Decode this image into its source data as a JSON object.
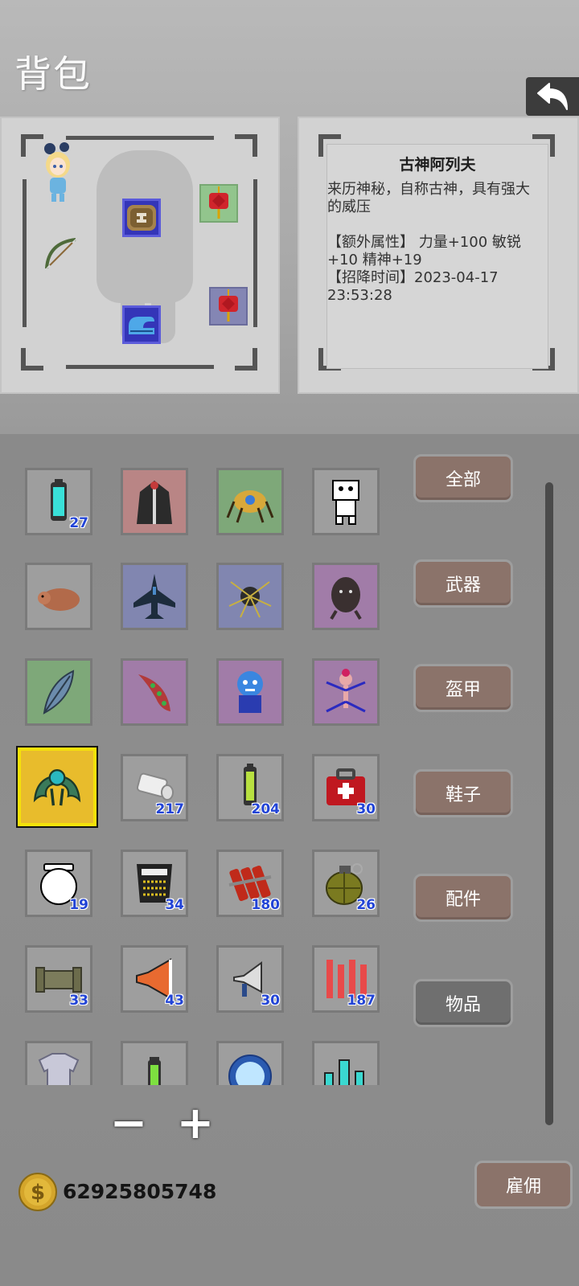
{
  "header": {
    "title": "背包",
    "back_icon": "back-arrow-icon"
  },
  "equipment": {
    "slots": [
      {
        "name": "avatar-slot",
        "icon": "chibi-girl-icon"
      },
      {
        "name": "head-slot",
        "icon": "brown-beast-head-icon"
      },
      {
        "name": "accessory-slot-1",
        "icon": "red-lantern-icon"
      },
      {
        "name": "weapon-slot",
        "icon": "bow-icon"
      },
      {
        "name": "accessory-slot-2",
        "icon": "red-lantern-icon"
      },
      {
        "name": "shoes-slot",
        "icon": "blue-boot-icon"
      }
    ]
  },
  "info": {
    "name": "古神阿列夫",
    "line1": "来历神秘，自称古神，具有强大",
    "line2": "的威压",
    "line3": "【额外属性】 力量+100 敏锐",
    "line4": "+10 精神+19",
    "line5": "【招降时间】2023-04-17",
    "line6": "23:53:28"
  },
  "items": [
    {
      "icon": "battery-cell-icon",
      "bg": "#9e9e9e",
      "qty": "27"
    },
    {
      "icon": "dark-cloak-icon",
      "bg": "#b98585",
      "qty": ""
    },
    {
      "icon": "golden-mech-creature-icon",
      "bg": "#7ea879",
      "qty": ""
    },
    {
      "icon": "white-robot-icon",
      "bg": "#9e9e9e",
      "qty": ""
    },
    {
      "icon": "boar-icon",
      "bg": "#9e9e9e",
      "qty": ""
    },
    {
      "icon": "fighter-jet-icon",
      "bg": "#8186b0",
      "qty": ""
    },
    {
      "icon": "spider-swarm-icon",
      "bg": "#8186b0",
      "qty": ""
    },
    {
      "icon": "dark-beast-icon",
      "bg": "#a17ca8",
      "qty": ""
    },
    {
      "icon": "feather-icon",
      "bg": "#7ea879",
      "qty": ""
    },
    {
      "icon": "tentacle-icon",
      "bg": "#a17ca8",
      "qty": ""
    },
    {
      "icon": "blue-goblin-icon",
      "bg": "#a17ca8",
      "qty": ""
    },
    {
      "icon": "demon-queen-icon",
      "bg": "#a17ca8",
      "qty": ""
    },
    {
      "icon": "green-mantis-icon",
      "bg": "#e8bc2c",
      "qty": "",
      "selected": true
    },
    {
      "icon": "paper-roll-icon",
      "bg": "#9e9e9e",
      "qty": "217"
    },
    {
      "icon": "battery-icon",
      "bg": "#9e9e9e",
      "qty": "204"
    },
    {
      "icon": "medkit-icon",
      "bg": "#9e9e9e",
      "qty": "30"
    },
    {
      "icon": "jar-icon",
      "bg": "#9e9e9e",
      "qty": "19"
    },
    {
      "icon": "keyboard-icon",
      "bg": "#9e9e9e",
      "qty": "34"
    },
    {
      "icon": "dynamite-icon",
      "bg": "#9e9e9e",
      "qty": "180"
    },
    {
      "icon": "grenade-icon",
      "bg": "#9e9e9e",
      "qty": "26"
    },
    {
      "icon": "pipe-icon",
      "bg": "#9e9e9e",
      "qty": "33"
    },
    {
      "icon": "orange-megaphone-icon",
      "bg": "#9e9e9e",
      "qty": "43"
    },
    {
      "icon": "megaphone-icon",
      "bg": "#9e9e9e",
      "qty": "30"
    },
    {
      "icon": "red-tubes-icon",
      "bg": "#9e9e9e",
      "qty": "187"
    },
    {
      "icon": "chainmail-icon",
      "bg": "#9e9e9e",
      "qty": ""
    },
    {
      "icon": "green-vial-icon",
      "bg": "#9e9e9e",
      "qty": ""
    },
    {
      "icon": "crystal-orb-icon",
      "bg": "#9e9e9e",
      "qty": ""
    },
    {
      "icon": "cyan-vials-icon",
      "bg": "#9e9e9e",
      "qty": ""
    }
  ],
  "filters": [
    {
      "label": "全部"
    },
    {
      "label": "武器"
    },
    {
      "label": "盔甲"
    },
    {
      "label": "鞋子"
    },
    {
      "label": "配件"
    },
    {
      "label": "物品",
      "active": true
    }
  ],
  "controls": {
    "minus": "−",
    "plus": "+"
  },
  "footer": {
    "gold": "62925805748",
    "coin_icon": "dollar-coin-icon",
    "hire_label": "雇佣"
  }
}
